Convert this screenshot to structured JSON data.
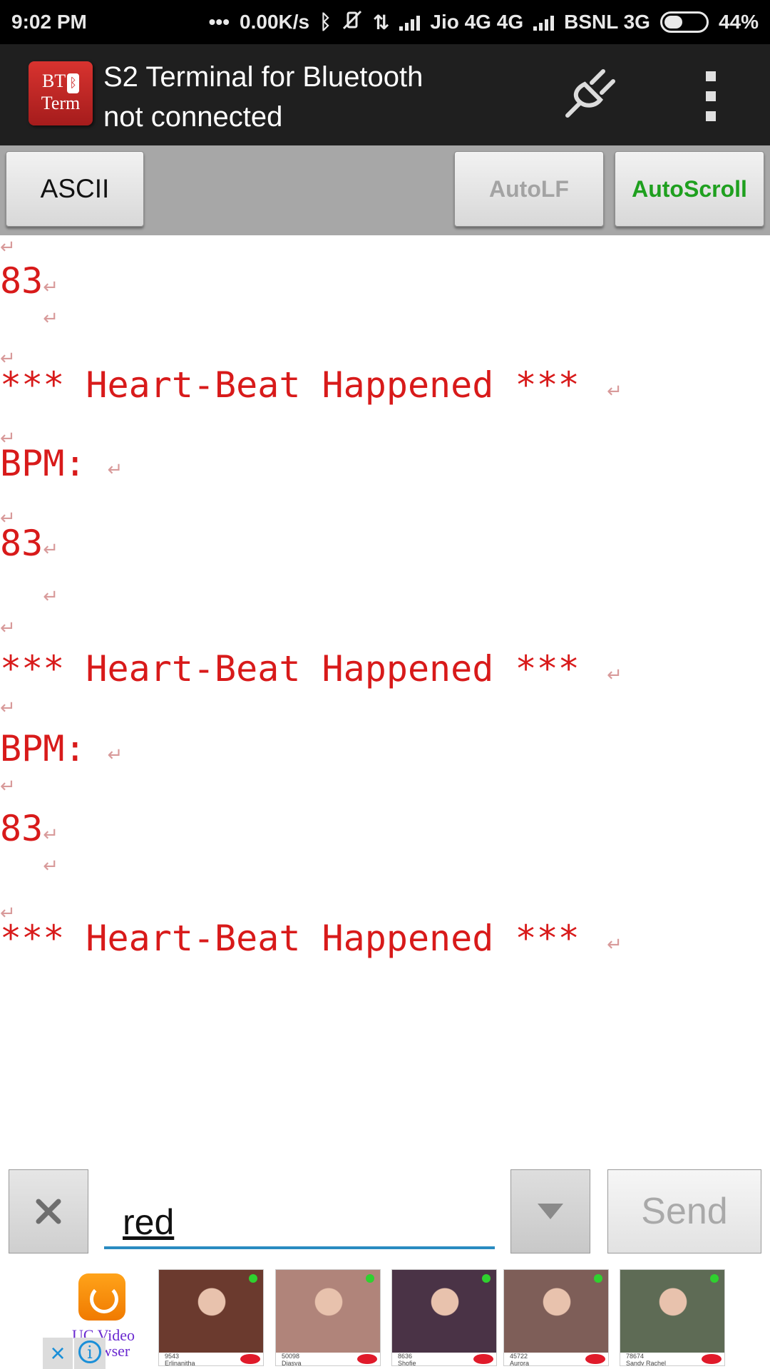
{
  "status_bar": {
    "time": "9:02 PM",
    "speed": "0.00K/s",
    "carrier1": "Jio 4G 4G",
    "carrier2": "BSNL 3G",
    "battery": "44%",
    "battery_level": 0.44,
    "icons": [
      "dots-icon",
      "bluetooth-icon",
      "vibrate-off-icon",
      "data-arrows-icon",
      "signal-icon",
      "signal-icon",
      "battery-icon"
    ]
  },
  "app_bar": {
    "logo_text_top": "BT",
    "logo_text_bottom": "Term",
    "title": "S2 Terminal for Bluetooth",
    "subtitle": "not connected",
    "actions": [
      "plug-icon",
      "overflow-menu-icon"
    ]
  },
  "toolbar": {
    "ascii_label": "ASCII",
    "autolf_label": "AutoLF",
    "autoscroll_label": "AutoScroll",
    "autolf_color": "#a3a3a3",
    "autoscroll_color": "#1fa01f"
  },
  "terminal": {
    "text_color": "#d81a1a",
    "linefeed_symbol": "↵",
    "lines": [
      {
        "text": "",
        "lf": true
      },
      {
        "text": "83",
        "lf": true
      },
      {
        "text": "  ",
        "lf": true
      },
      {
        "text": "",
        "lf": true
      },
      {
        "text": "*** Heart-Beat Happened *** ",
        "lf": true
      },
      {
        "text": "",
        "lf": true
      },
      {
        "text": "BPM: ",
        "lf": true
      },
      {
        "text": "",
        "lf": true
      },
      {
        "text": "83",
        "lf": true
      },
      {
        "text": "  ",
        "lf": true
      },
      {
        "text": "",
        "lf": true
      },
      {
        "text": "*** Heart-Beat Happened *** ",
        "lf": true
      },
      {
        "text": "",
        "lf": true
      },
      {
        "text": "BPM: ",
        "lf": true
      },
      {
        "text": "",
        "lf": true
      },
      {
        "text": "83",
        "lf": true
      },
      {
        "text": "  ",
        "lf": true
      },
      {
        "text": "",
        "lf": true
      },
      {
        "text": "*** Heart-Beat Happened *** ",
        "lf": true
      }
    ]
  },
  "input": {
    "value": "red",
    "send_label": "Send"
  },
  "ad": {
    "app_label": "UC Video Browser",
    "profiles": [
      {
        "views": "9543",
        "name": "Erlinanitha",
        "color": "#6b3a2e"
      },
      {
        "views": "50098",
        "name": "Diasya",
        "color": "#b0847a"
      },
      {
        "views": "8636",
        "name": "Shofie",
        "color": "#4a3346"
      },
      {
        "views": "45722",
        "name": "Aurora",
        "color": "#7e5e58"
      },
      {
        "views": "78674",
        "name": "Sandy Rachel",
        "color": "#5e6b55"
      }
    ]
  }
}
